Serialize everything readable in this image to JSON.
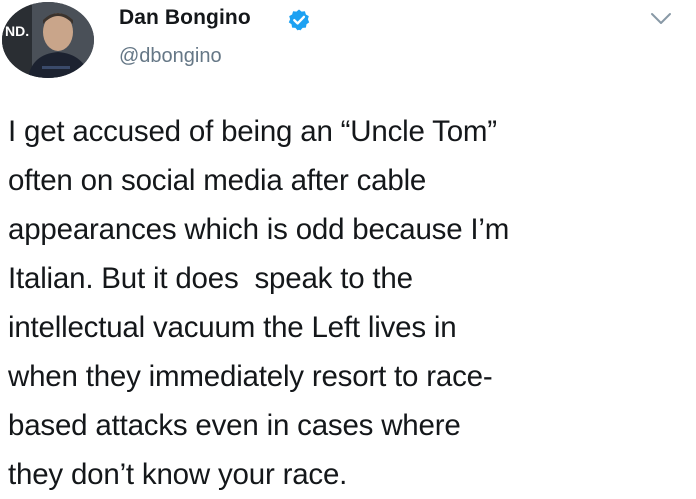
{
  "author": {
    "display_name": "Dan Bongino",
    "handle": "@dbongino",
    "avatar_label": "ND."
  },
  "tweet": {
    "lines": [
      "I get accused of being an “Uncle Tom”",
      "often on social media after cable",
      "appearances which is odd because I’m",
      "Italian. But it does  speak to the",
      "intellectual vacuum the Left lives in",
      "when they immediately resort to race-",
      "based attacks even in cases where",
      "they don’t know your race."
    ]
  },
  "icons": {
    "verified": "verified-badge-icon",
    "menu": "chevron-down-icon"
  },
  "colors": {
    "text": "#14171a",
    "secondary": "#657786",
    "verified_blue": "#1da1f2"
  }
}
